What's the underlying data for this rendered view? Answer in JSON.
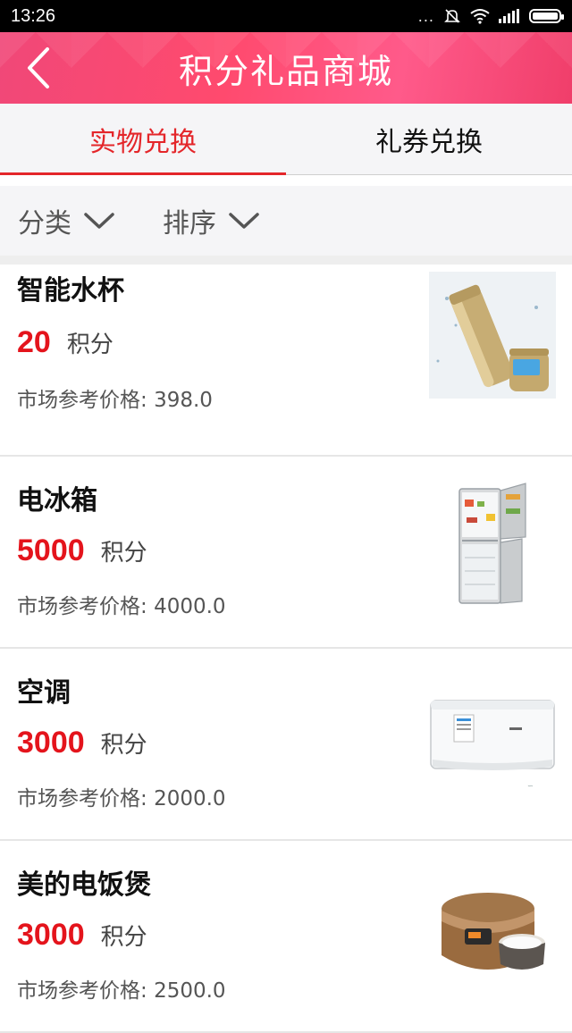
{
  "status_bar": {
    "time": "13:26",
    "dots": "..."
  },
  "header": {
    "title": "积分礼品商城"
  },
  "tabs": [
    {
      "label": "实物兑换",
      "active": true
    },
    {
      "label": "礼券兑换",
      "active": false
    }
  ],
  "filters": [
    {
      "label": "分类"
    },
    {
      "label": "排序"
    }
  ],
  "items": [
    {
      "name": "智能水杯",
      "points": "20",
      "unit": "积分",
      "price_label": "市场参考价格:",
      "price": "398.0"
    },
    {
      "name": "电冰箱",
      "points": "5000",
      "unit": "积分",
      "price_label": "市场参考价格:",
      "price": "4000.0"
    },
    {
      "name": "空调",
      "points": "3000",
      "unit": "积分",
      "price_label": "市场参考价格:",
      "price": "2000.0"
    },
    {
      "name": "美的电饭煲",
      "points": "3000",
      "unit": "积分",
      "price_label": "市场参考价格:",
      "price": "2500.0"
    }
  ],
  "colors": {
    "accent": "#e4262a",
    "header": "#ff4a6e",
    "points": "#e4141c"
  }
}
